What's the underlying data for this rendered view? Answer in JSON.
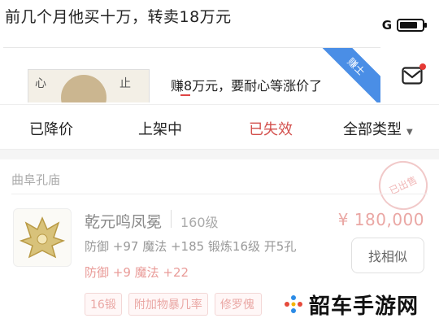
{
  "headline": "前几个月他买十万，转卖18万元",
  "status": {
    "network": "G",
    "battery_fraction": 0.8
  },
  "banner": {
    "ribbon": "赚士",
    "earn_text": "赚8万元，要耐心等涨价了",
    "thumb_chars": [
      "心",
      "止"
    ]
  },
  "tabs": [
    {
      "label": "已降价"
    },
    {
      "label": "上架中"
    },
    {
      "label": "已失效"
    },
    {
      "label": "全部类型"
    }
  ],
  "item": {
    "shop": "曲阜孔庙",
    "stamp": "已出售",
    "name": "乾元鸣凤冕",
    "level": "160级",
    "price": "¥ 180,000",
    "stats": "防御 +97 魔法 +185 锻炼16级 开5孔",
    "bonus": "防御 +9 魔法 +22",
    "button": "找相似",
    "tags": [
      "16锻",
      "附加物暴几率",
      "修罗傀"
    ]
  },
  "watermark": "韶车手游网",
  "colors": {
    "accent": "#d3504d",
    "ribbon": "#4a8ee6",
    "price": "#eaa7a4"
  }
}
